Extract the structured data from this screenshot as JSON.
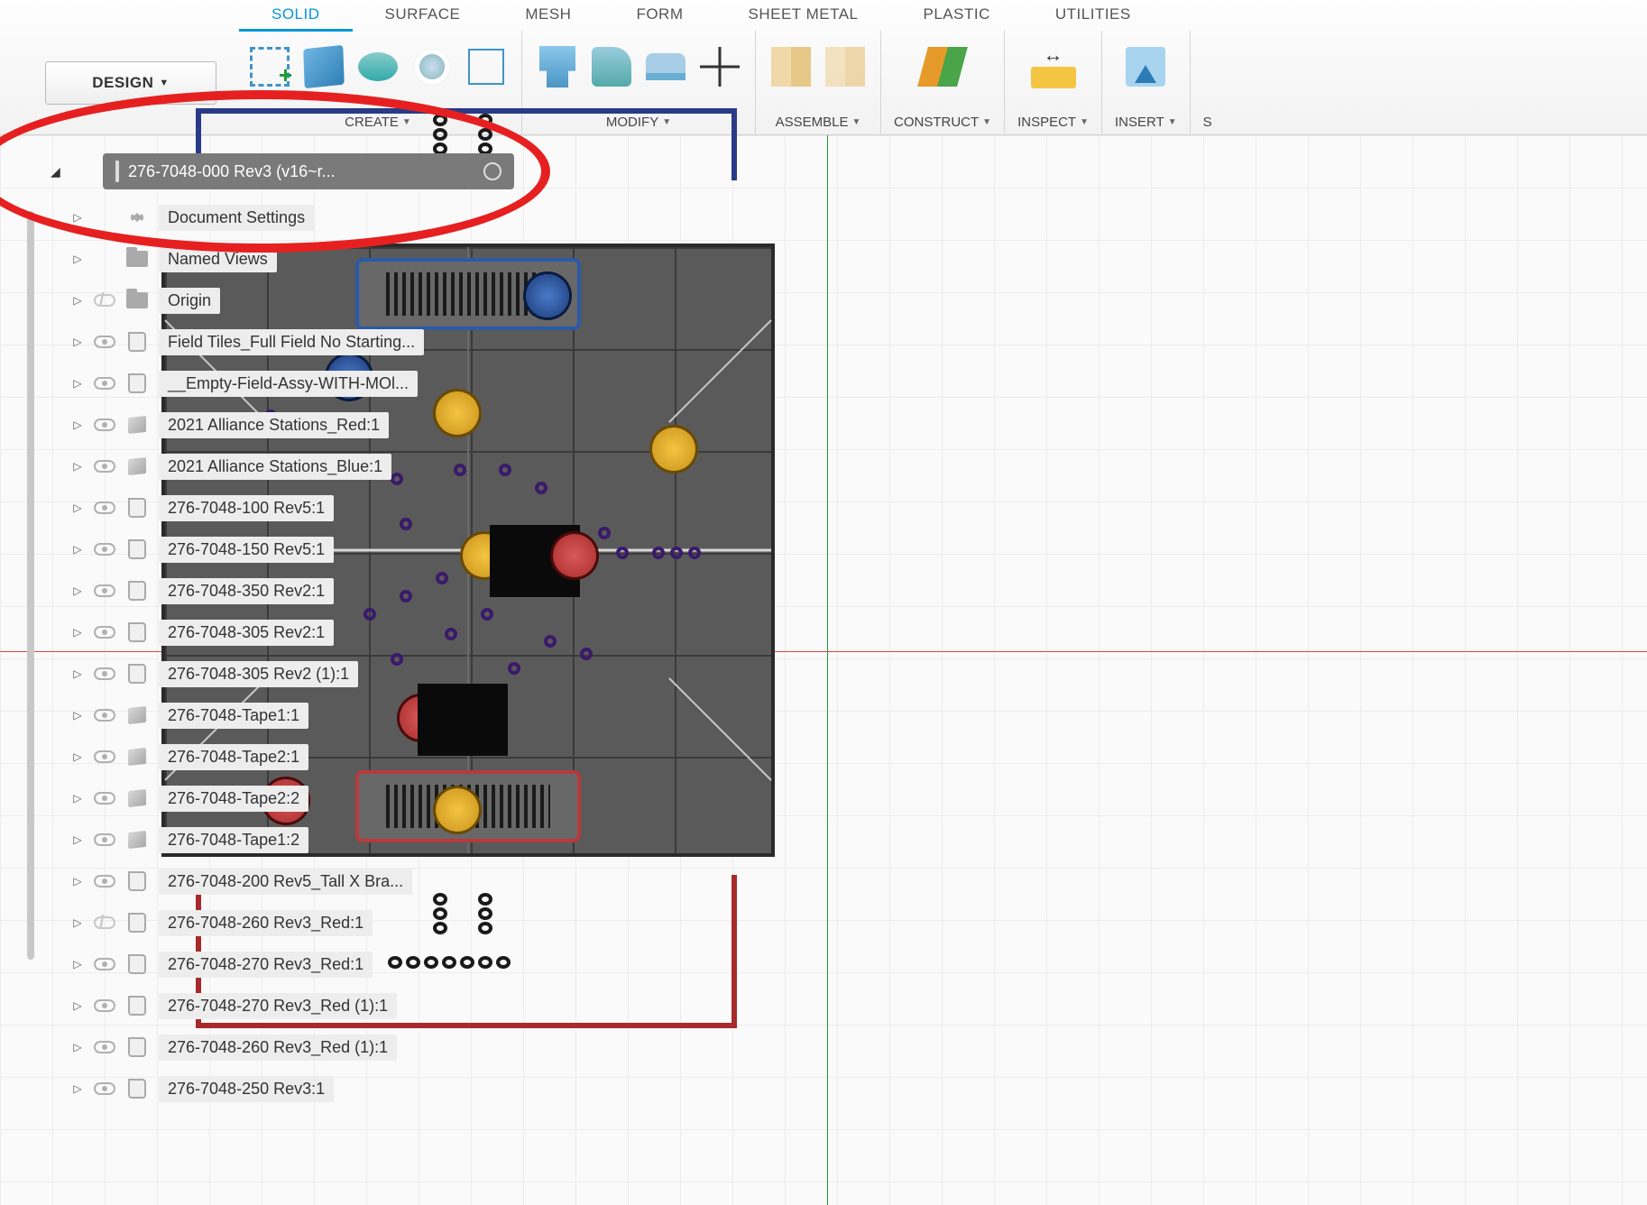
{
  "workspace": "DESIGN",
  "tabs": [
    {
      "label": "SOLID",
      "active": true
    },
    {
      "label": "SURFACE",
      "active": false
    },
    {
      "label": "MESH",
      "active": false
    },
    {
      "label": "FORM",
      "active": false
    },
    {
      "label": "SHEET METAL",
      "active": false
    },
    {
      "label": "PLASTIC",
      "active": false
    },
    {
      "label": "UTILITIES",
      "active": false
    }
  ],
  "groups": {
    "create": "CREATE",
    "modify": "MODIFY",
    "assemble": "ASSEMBLE",
    "construct": "CONSTRUCT",
    "inspect": "INSPECT",
    "insert": "INSERT",
    "select": "S"
  },
  "root_label": "276-7048-000 Rev3 (v16~r...",
  "tree": [
    {
      "tri": "▷",
      "vis": "none",
      "type": "gear",
      "label": "Document Settings"
    },
    {
      "tri": "▷",
      "vis": "none",
      "type": "folder",
      "label": "Named Views"
    },
    {
      "tri": "▷",
      "vis": "off",
      "type": "folder",
      "label": "Origin"
    },
    {
      "tri": "▷",
      "vis": "on",
      "type": "comp",
      "label": "Field Tiles_Full Field No Starting..."
    },
    {
      "tri": "▷",
      "vis": "on",
      "type": "comp",
      "label": "__Empty-Field-Assy-WITH-MOl..."
    },
    {
      "tri": "▷",
      "vis": "on",
      "type": "body",
      "label": "2021 Alliance Stations_Red:1"
    },
    {
      "tri": "▷",
      "vis": "on",
      "type": "body",
      "label": "2021 Alliance Stations_Blue:1"
    },
    {
      "tri": "▷",
      "vis": "on",
      "type": "comp",
      "label": "276-7048-100 Rev5:1"
    },
    {
      "tri": "▷",
      "vis": "on",
      "type": "comp",
      "label": "276-7048-150 Rev5:1"
    },
    {
      "tri": "▷",
      "vis": "on",
      "type": "comp",
      "label": "276-7048-350 Rev2:1"
    },
    {
      "tri": "▷",
      "vis": "on",
      "type": "comp",
      "label": "276-7048-305 Rev2:1"
    },
    {
      "tri": "▷",
      "vis": "on",
      "type": "comp",
      "label": "276-7048-305 Rev2 (1):1"
    },
    {
      "tri": "▷",
      "vis": "on",
      "type": "body",
      "label": "276-7048-Tape1:1"
    },
    {
      "tri": "▷",
      "vis": "on",
      "type": "body",
      "label": "276-7048-Tape2:1"
    },
    {
      "tri": "▷",
      "vis": "on",
      "type": "body",
      "label": "276-7048-Tape2:2"
    },
    {
      "tri": "▷",
      "vis": "on",
      "type": "body",
      "label": "276-7048-Tape1:2"
    },
    {
      "tri": "▷",
      "vis": "on",
      "type": "comp",
      "label": "276-7048-200 Rev5_Tall X Bra..."
    },
    {
      "tri": "▷",
      "vis": "off",
      "type": "comp",
      "label": "276-7048-260 Rev3_Red:1"
    },
    {
      "tri": "▷",
      "vis": "on",
      "type": "comp",
      "label": "276-7048-270 Rev3_Red:1"
    },
    {
      "tri": "▷",
      "vis": "on",
      "type": "comp",
      "label": "276-7048-270 Rev3_Red (1):1"
    },
    {
      "tri": "▷",
      "vis": "on",
      "type": "comp",
      "label": "276-7048-260 Rev3_Red (1):1"
    },
    {
      "tri": "▷",
      "vis": "on",
      "type": "comp",
      "label": "276-7048-250 Rev3:1"
    }
  ]
}
